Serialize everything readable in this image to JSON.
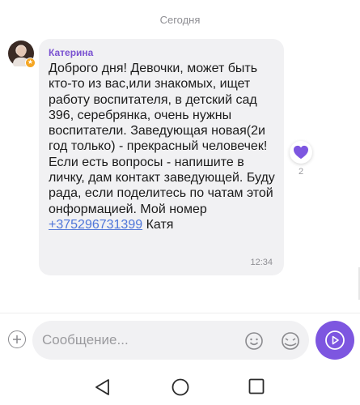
{
  "date_separator": "Сегодня",
  "message": {
    "sender": "Катерина",
    "text": "Доброго дня! Девочки, может быть кто-то из вас,или знакомых, ищет работу воспитателя, в детский сад 396, серебрянка, очень нужны воспитатели. Заведующая новая(2и год только) - прекрасный человечек! Если есть вопросы - напишите в личку, дам контакт заведующей. Буду рада, если поделитесь по чатам этой онформацией. Мой номер",
    "phone": "+375296731399",
    "signature": " Катя",
    "time": "12:34",
    "reaction": {
      "icon": "heart-icon",
      "count": "2"
    }
  },
  "composer": {
    "placeholder": "Сообщение...",
    "attach_icon": "plus-circle-icon",
    "emoji_icon": "smiley-icon",
    "sticker_icon": "sticker-icon",
    "send_icon": "send-icon"
  },
  "colors": {
    "accent": "#7d56e0",
    "sender_name": "#7a52d1",
    "link": "#4f76d9",
    "bubble": "#f1f1f3"
  },
  "navigation": {
    "back_icon": "triangle-back-icon",
    "home_icon": "circle-home-icon",
    "recent_icon": "square-recents-icon"
  }
}
